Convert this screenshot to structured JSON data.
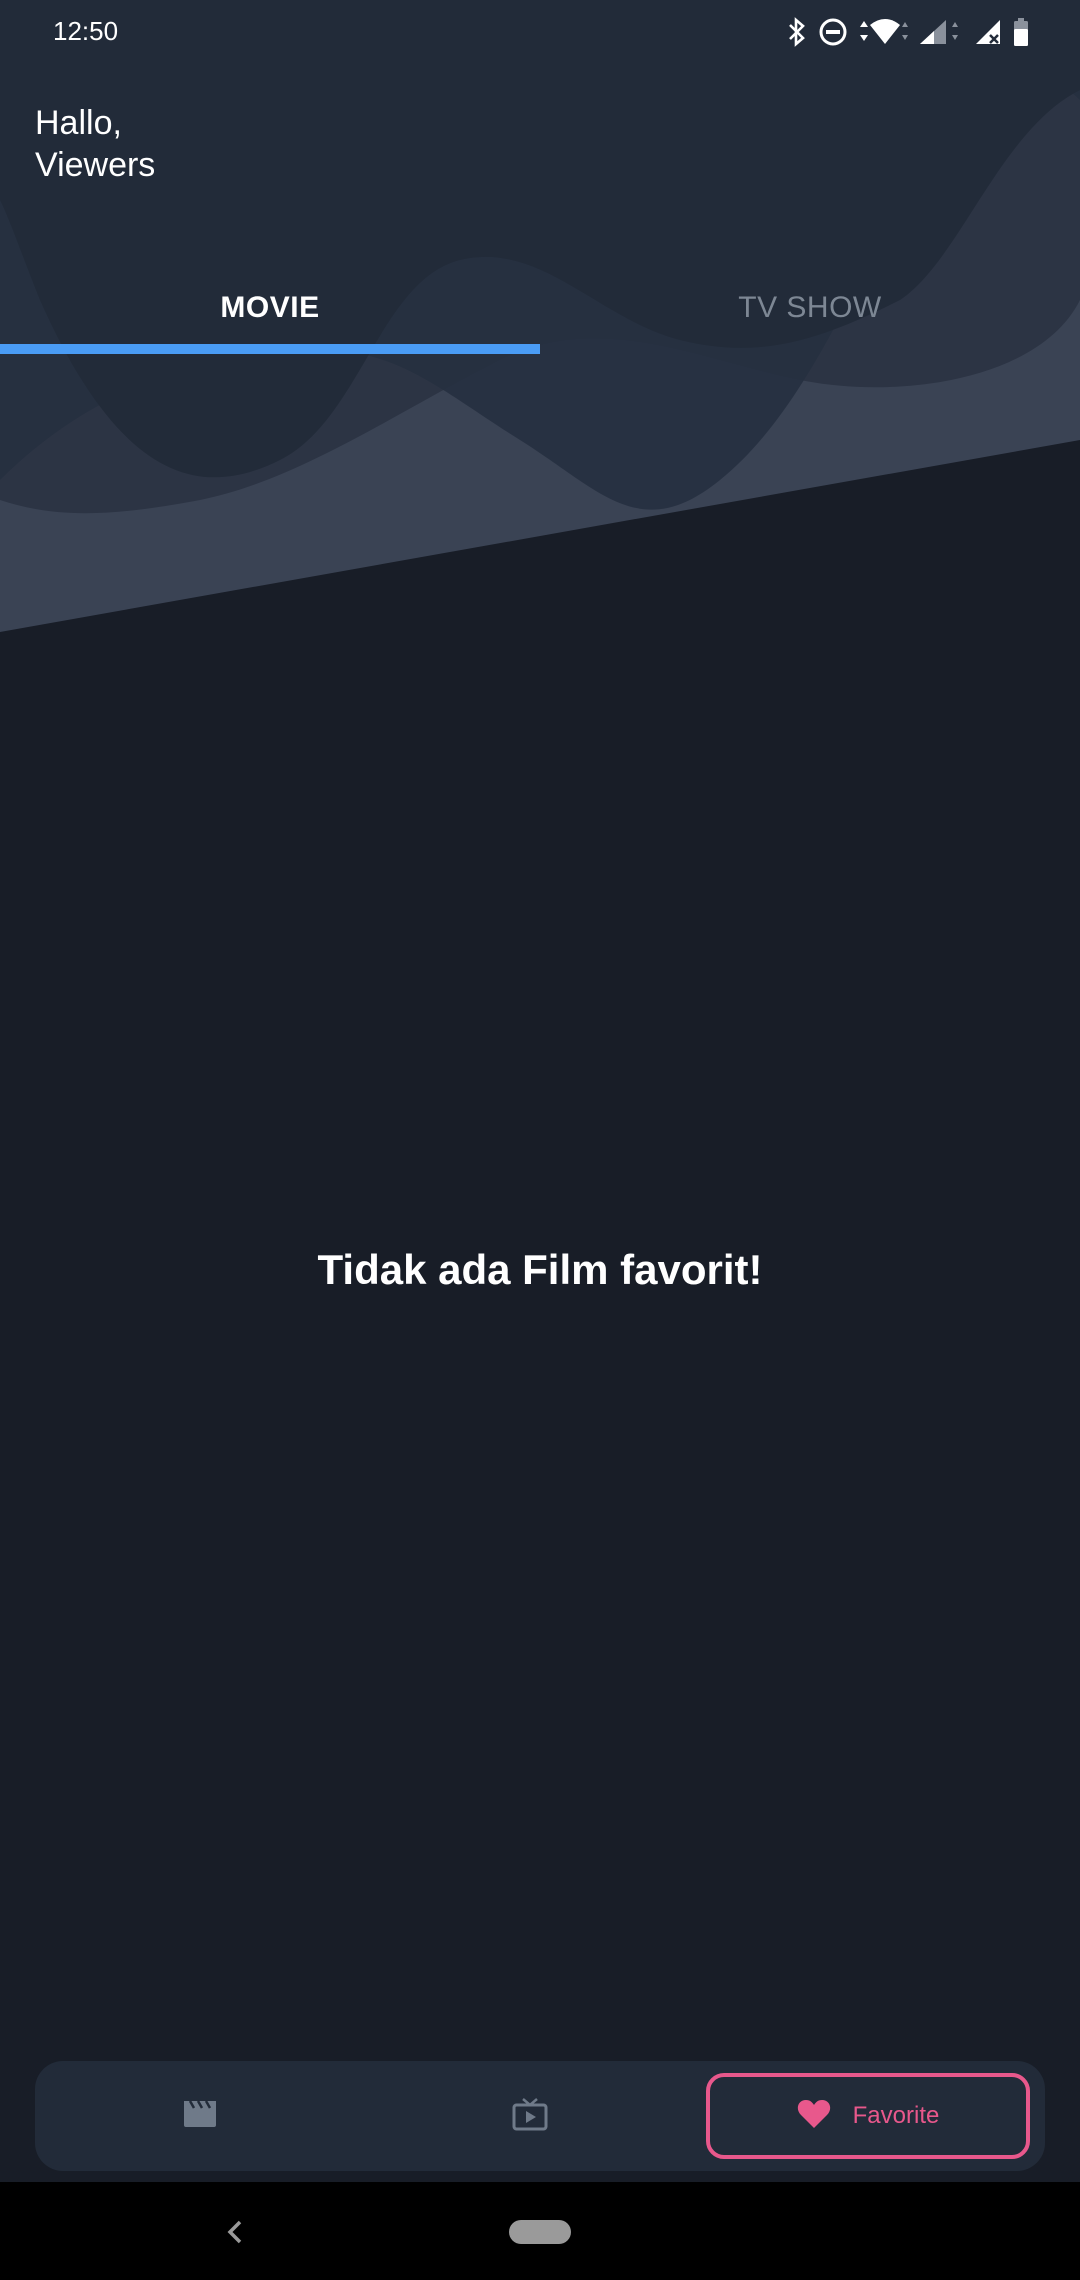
{
  "status_bar": {
    "time": "12:50",
    "icons": [
      "bluetooth-icon",
      "do-not-disturb-icon",
      "wifi-icon",
      "signal-icon",
      "signal-no-data-icon",
      "battery-icon"
    ]
  },
  "header": {
    "greeting_line1": "Hallo,",
    "greeting_line2": "Viewers"
  },
  "tabs": [
    {
      "label": "MOVIE",
      "selected": true
    },
    {
      "label": "TV SHOW",
      "selected": false
    }
  ],
  "content": {
    "empty_message": "Tidak ada Film favorit!"
  },
  "bottom_nav": {
    "items": [
      {
        "icon": "movie-clapper-icon",
        "label": ""
      },
      {
        "icon": "tv-play-icon",
        "label": ""
      },
      {
        "icon": "heart-icon",
        "label": "Favorite",
        "selected": true
      }
    ]
  },
  "colors": {
    "background": "#181d27",
    "header": "#222b39",
    "tab_indicator": "#4a9cf5",
    "accent_pink": "#e8588c",
    "inactive_text": "#7d8794"
  }
}
